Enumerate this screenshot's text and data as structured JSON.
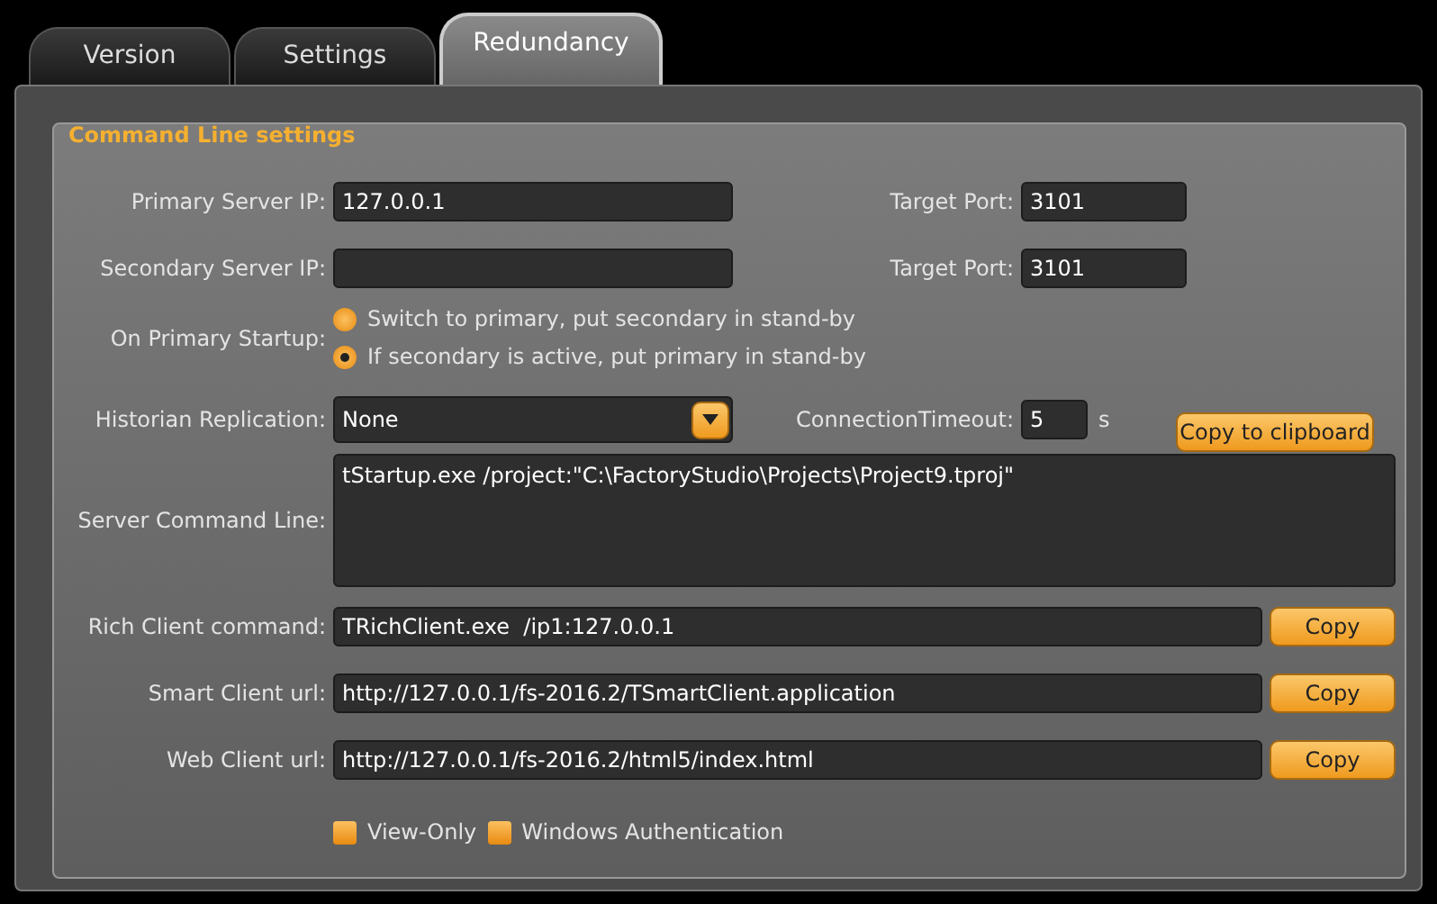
{
  "tabs": [
    {
      "label": "Version",
      "selected": false
    },
    {
      "label": "Settings",
      "selected": false
    },
    {
      "label": "Redundancy",
      "selected": true
    }
  ],
  "group": {
    "title": "Command Line settings"
  },
  "servers": [
    {
      "label": "Primary Server IP:",
      "value": "127.0.0.1",
      "port_label": "Target Port:",
      "port": "3101"
    },
    {
      "label": "Secondary Server IP:",
      "port_label": "Target Port:",
      "port": "3101"
    }
  ],
  "on_primary_startup": {
    "label": "On Primary Startup:",
    "options": [
      {
        "label": "Switch to primary, put secondary in stand-by",
        "selected": false
      },
      {
        "label": "If secondary is active, put primary in stand-by",
        "selected": true
      }
    ]
  },
  "historian_replication": {
    "label": "Historian Replication:",
    "value": "None"
  },
  "connection_timeout": {
    "label": "ConnectionTimeout:",
    "value": "5",
    "unit": "s"
  },
  "copy_to_clipboard": "Copy to clipboard",
  "server_command_line": {
    "label": "Server Command Line:",
    "value": "tStartup.exe /project:\"C:\\FactoryStudio\\Projects\\Project9.tproj\""
  },
  "clients": [
    {
      "label": "Rich Client command:",
      "value": "TRichClient.exe  /ip1:127.0.0.1",
      "button": "Copy"
    },
    {
      "label": "Smart Client url:",
      "value": "http://127.0.0.1/fs-2016.2/TSmartClient.application",
      "button": "Copy"
    },
    {
      "label": "Web Client url:",
      "value": "http://127.0.0.1/fs-2016.2/html5/index.html",
      "button": "Copy"
    }
  ],
  "checkboxes": [
    {
      "label": "View-Only",
      "checked": false
    },
    {
      "label": "Windows Authentication",
      "checked": false
    }
  ]
}
